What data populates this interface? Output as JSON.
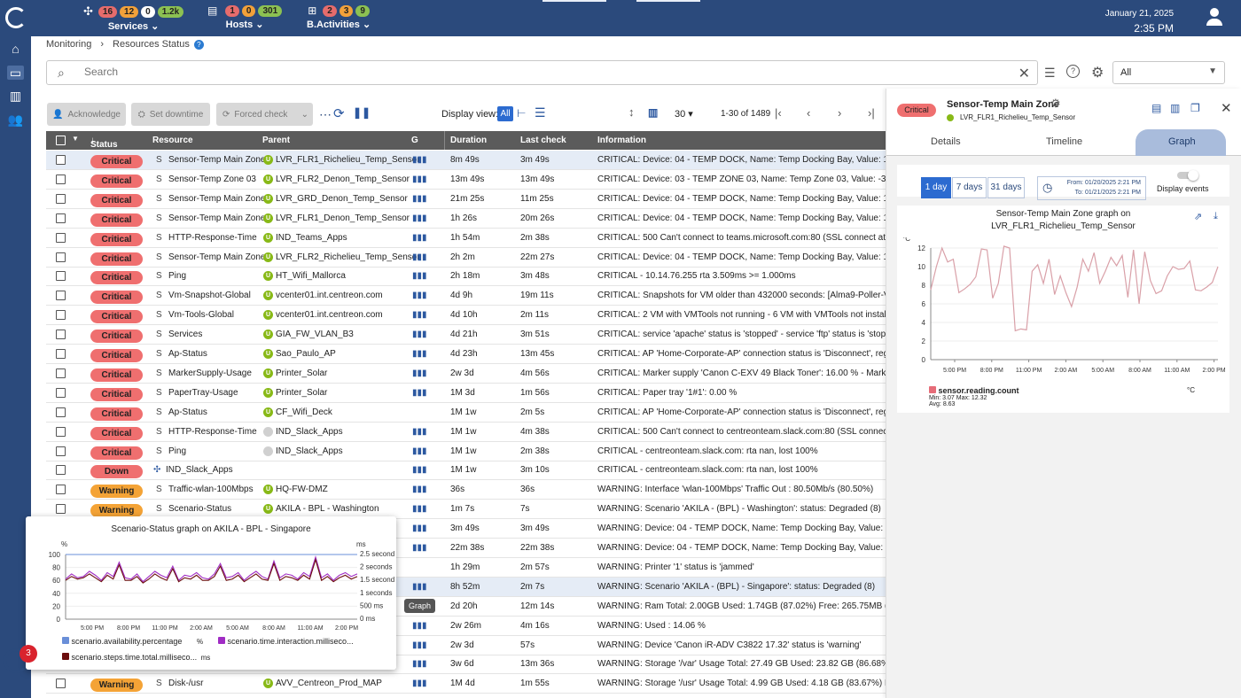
{
  "topbar": {
    "services": {
      "label": "Services",
      "counts": [
        "16",
        "12",
        "0",
        "1.2k"
      ]
    },
    "hosts": {
      "label": "Hosts",
      "counts": [
        "1",
        "0",
        "301"
      ]
    },
    "bactivities": {
      "label": "B.Activities",
      "counts": [
        "2",
        "3",
        "9"
      ]
    },
    "date": "January 21, 2025",
    "time": "2:35 PM"
  },
  "breadcrumb": {
    "root": "Monitoring",
    "current": "Resources Status"
  },
  "search": {
    "placeholder": "Search",
    "filter_value": "All"
  },
  "actions": {
    "acknowledge": "Acknowledge",
    "set_downtime": "Set downtime",
    "forced_check": "Forced check"
  },
  "view": {
    "display_view_label": "Display view:",
    "all_label": "All",
    "per_page": "30",
    "pagination": "1-30 of 1489"
  },
  "columns": {
    "status": "Status",
    "resource": "Resource",
    "parent": "Parent",
    "graph": "G",
    "duration": "Duration",
    "last_check": "Last check",
    "information": "Information"
  },
  "rows": [
    {
      "status": "Critical",
      "type": "S",
      "resource": "Sensor-Temp Main Zone",
      "parent": "LVR_FLR1_Richelieu_Temp_Sensor",
      "pcolor": "green",
      "graph": true,
      "duration": "8m 49s",
      "last_check": "3m 49s",
      "info": "CRITICAL: Device: 04 - TEMP DOCK, Name: Temp Docking Bay, Value: 12.7°C (2025-0"
    },
    {
      "status": "Critical",
      "type": "S",
      "resource": "Sensor-Temp Zone 03",
      "parent": "LVR_FLR2_Denon_Temp_Sensor",
      "pcolor": "green",
      "graph": true,
      "duration": "13m 49s",
      "last_check": "13m 49s",
      "info": "CRITICAL: Device: 03 - TEMP ZONE 03, Name: Temp Zone 03, Value: -30°C (2025-01-"
    },
    {
      "status": "Critical",
      "type": "S",
      "resource": "Sensor-Temp Main Zone",
      "parent": "LVR_GRD_Denon_Temp_Sensor",
      "pcolor": "green",
      "graph": true,
      "duration": "21m 25s",
      "last_check": "11m 25s",
      "info": "CRITICAL: Device: 04 - TEMP DOCK, Name: Temp Docking Bay, Value: 14.6°C (2025-0"
    },
    {
      "status": "Critical",
      "type": "S",
      "resource": "Sensor-Temp Main Zone",
      "parent": "LVR_FLR1_Denon_Temp_Sensor",
      "pcolor": "green",
      "graph": true,
      "duration": "1h 26s",
      "last_check": "20m 26s",
      "info": "CRITICAL: Device: 04 - TEMP DOCK, Name: Temp Docking Bay, Value: 14.1°C (2025-0"
    },
    {
      "status": "Critical",
      "type": "S",
      "resource": "HTTP-Response-Time",
      "parent": "IND_Teams_Apps",
      "pcolor": "green",
      "graph": true,
      "duration": "1h 54m",
      "last_check": "2m 38s",
      "info": "CRITICAL: 500 Can't connect to teams.microsoft.com:80 (SSL connect attempt faile"
    },
    {
      "status": "Critical",
      "type": "S",
      "resource": "Sensor-Temp Main Zone",
      "parent": "LVR_FLR2_Richelieu_Temp_Sensor",
      "pcolor": "green",
      "graph": true,
      "duration": "2h 2m",
      "last_check": "22m 27s",
      "info": "CRITICAL: Device: 04 - TEMP DOCK, Name: Temp Docking Bay, Value: 11.7°C (2025-0"
    },
    {
      "status": "Critical",
      "type": "S",
      "resource": "Ping",
      "parent": "HT_Wifi_Mallorca",
      "pcolor": "green",
      "graph": true,
      "duration": "2h 18m",
      "last_check": "3m 48s",
      "info": "CRITICAL - 10.14.76.255 rta 3.509ms >= 1.000ms"
    },
    {
      "status": "Critical",
      "type": "S",
      "resource": "Vm-Snapshot-Global",
      "parent": "vcenter01.int.centreon.com",
      "pcolor": "green",
      "graph": true,
      "duration": "4d 9h",
      "last_check": "19m 11s",
      "info": "CRITICAL: Snapshots for VM older than 432000 seconds: [Alma9-Poller-VCenter] [CE"
    },
    {
      "status": "Critical",
      "type": "S",
      "resource": "Vm-Tools-Global",
      "parent": "vcenter01.int.centreon.com",
      "pcolor": "green",
      "graph": true,
      "duration": "4d 10h",
      "last_check": "2m 11s",
      "info": "CRITICAL: 2 VM with VMTools not running - 6 VM with VMTools not installed"
    },
    {
      "status": "Critical",
      "type": "S",
      "resource": "Services",
      "parent": "GIA_FW_VLAN_B3",
      "pcolor": "green",
      "graph": true,
      "duration": "4d 21h",
      "last_check": "3m 51s",
      "info": "CRITICAL: service 'apache' status is 'stopped' - service 'ftp' status is 'stopped'"
    },
    {
      "status": "Critical",
      "type": "S",
      "resource": "Ap-Status",
      "parent": "Sao_Paulo_AP",
      "pcolor": "green",
      "graph": true,
      "duration": "4d 23h",
      "last_check": "13m 45s",
      "info": "CRITICAL: AP 'Home-Corporate-AP' connection status is 'Disconnect', registration sta"
    },
    {
      "status": "Critical",
      "type": "S",
      "resource": "MarkerSupply-Usage",
      "parent": "Printer_Solar",
      "pcolor": "green",
      "graph": true,
      "duration": "2w 3d",
      "last_check": "4m 56s",
      "info": "CRITICAL: Marker supply 'Canon C-EXV 49 Black Toner': 16.00 % - Marker supply 'Wa"
    },
    {
      "status": "Critical",
      "type": "S",
      "resource": "PaperTray-Usage",
      "parent": "Printer_Solar",
      "pcolor": "green",
      "graph": true,
      "duration": "1M 3d",
      "last_check": "1m 56s",
      "info": "CRITICAL: Paper tray '1#1': 0.00 %"
    },
    {
      "status": "Critical",
      "type": "S",
      "resource": "Ap-Status",
      "parent": "CF_Wifi_Deck",
      "pcolor": "green",
      "graph": false,
      "duration": "1M 1w",
      "last_check": "2m 5s",
      "info": "CRITICAL: AP 'Home-Corporate-AP' connection status is 'Disconnect', registration sta"
    },
    {
      "status": "Critical",
      "type": "S",
      "resource": "HTTP-Response-Time",
      "parent": "IND_Slack_Apps",
      "pcolor": "grey",
      "graph": true,
      "duration": "1M 1w",
      "last_check": "4m 38s",
      "info": "CRITICAL: 500 Can't connect to centreonteam.slack.com:80 (SSL connect attempt fa"
    },
    {
      "status": "Critical",
      "type": "S",
      "resource": "Ping",
      "parent": "IND_Slack_Apps",
      "pcolor": "grey",
      "graph": true,
      "duration": "1M 1w",
      "last_check": "2m 38s",
      "info": "CRITICAL - centreonteam.slack.com: rta nan, lost 100%"
    },
    {
      "status": "Down",
      "type": "",
      "resource": "IND_Slack_Apps",
      "parent": "",
      "pcolor": "",
      "graph": true,
      "duration": "1M 1w",
      "last_check": "3m 10s",
      "info": "CRITICAL - centreonteam.slack.com: rta nan, lost 100%"
    },
    {
      "status": "Warning",
      "type": "S",
      "resource": "Traffic-wlan-100Mbps",
      "parent": "HQ-FW-DMZ",
      "pcolor": "green",
      "graph": true,
      "duration": "36s",
      "last_check": "36s",
      "info": "WARNING: Interface 'wlan-100Mbps' Traffic Out : 80.50Mb/s (80.50%)"
    },
    {
      "status": "Warning",
      "type": "S",
      "resource": "Scenario-Status",
      "parent": "AKILA - BPL - Washington",
      "pcolor": "green",
      "graph": true,
      "duration": "1m 7s",
      "last_check": "7s",
      "info": "WARNING: Scenario 'AKILA - (BPL) - Washington': status: Degraded (8)"
    },
    {
      "status": "",
      "type": "",
      "resource": "",
      "parent": "",
      "pcolor": "",
      "graph": true,
      "duration": "3m 49s",
      "last_check": "3m 49s",
      "info": "WARNING: Device: 04 - TEMP DOCK, Name: Temp Docking Bay, Value: 9.7°C (2025-0"
    },
    {
      "status": "",
      "type": "",
      "resource": "",
      "parent": "",
      "pcolor": "",
      "graph": true,
      "duration": "22m 38s",
      "last_check": "22m 38s",
      "info": "WARNING: Device: 04 - TEMP DOCK, Name: Temp Docking Bay, Value: 9.4°C (2025-0"
    },
    {
      "status": "",
      "type": "",
      "resource": "",
      "parent": "",
      "pcolor": "",
      "graph": false,
      "duration": "1h 29m",
      "last_check": "2m 57s",
      "info": "WARNING: Printer '1' status is 'jammed'"
    },
    {
      "status": "",
      "type": "",
      "resource": "",
      "parent": "",
      "pcolor": "",
      "graph": true,
      "duration": "8h 52m",
      "last_check": "2m 7s",
      "info": "WARNING: Scenario 'AKILA - (BPL) - Singapore': status: Degraded (8)"
    },
    {
      "status": "",
      "type": "",
      "resource": "",
      "parent": "",
      "pcolor": "",
      "graph": false,
      "duration": "2d 20h",
      "last_check": "12m 14s",
      "info": "WARNING: Ram Total: 2.00GB Used: 1.74GB (87.02%) Free: 265.75MB (12.98%)"
    },
    {
      "status": "",
      "type": "",
      "resource": "",
      "parent": "",
      "pcolor": "",
      "graph": true,
      "duration": "2w 26m",
      "last_check": "4m 16s",
      "info": "WARNING: Used : 14.06 %"
    },
    {
      "status": "",
      "type": "",
      "resource": "",
      "parent": "",
      "pcolor": "",
      "graph": true,
      "duration": "2w 3d",
      "last_check": "57s",
      "info": "WARNING: Device 'Canon iR-ADV C3822 17.32' status is 'warning'"
    },
    {
      "status": "",
      "type": "",
      "resource": "",
      "parent": "",
      "pcolor": "",
      "graph": true,
      "duration": "3w 6d",
      "last_check": "13m 36s",
      "info": "WARNING: Storage '/var' Usage Total: 27.49 GB Used: 23.82 GB (86.68%) Free: 3.66 G"
    },
    {
      "status": "Warning",
      "type": "S",
      "resource": "Disk-/usr",
      "parent": "AVV_Centreon_Prod_MAP",
      "pcolor": "green",
      "graph": true,
      "duration": "1M 4d",
      "last_check": "1m 55s",
      "info": "WARNING: Storage '/usr' Usage Total: 4.99 GB Used: 4.18 GB (83.67%) Free: 834.61"
    }
  ],
  "tooltip": "Graph",
  "right_panel": {
    "status": "Critical",
    "title": "Sensor-Temp Main Zone",
    "parent": "LVR_FLR1_Richelieu_Temp_Sensor",
    "tabs": [
      "Details",
      "Timeline",
      "Graph"
    ],
    "ranges": [
      "1 day",
      "7 days",
      "31 days"
    ],
    "from": "From: 01/20/2025 2:21 PM",
    "to": "To: 01/21/2025 2:21 PM",
    "display_events": "Display events",
    "graph_title_1": "Sensor-Temp Main Zone graph on",
    "graph_title_2": "LVR_FLR1_Richelieu_Temp_Sensor",
    "unit": "°C",
    "legend_name": "sensor.reading.count",
    "legend_unit": "°C",
    "legend_minmax": "Min: 3.07  Max: 12.32",
    "legend_avg": "Avg: 8.63"
  },
  "popup": {
    "title": "Scenario-Status graph on AKILA - BPL - Singapore",
    "left_unit": "%",
    "right_unit": "ms",
    "legend": [
      {
        "name": "scenario.availability.percentage",
        "unit": "%",
        "color": "#6a8fd8"
      },
      {
        "name": "scenario.time.interaction.milliseco...",
        "unit": "",
        "color": "#a02cc4"
      },
      {
        "name": "scenario.steps.time.total.milliseco...",
        "unit": "ms",
        "color": "#6b0d0d"
      }
    ]
  },
  "notification_count": "3",
  "chart_data": [
    {
      "type": "line",
      "title": "Sensor-Temp Main Zone graph on LVR_FLR1_Richelieu_Temp_Sensor",
      "ylabel": "°C",
      "ylim": [
        0,
        12
      ],
      "yticks": [
        0,
        2,
        4,
        6,
        8,
        10,
        12
      ],
      "xticks": [
        "5:00 PM",
        "8:00 PM",
        "11:00 PM",
        "2:00 AM",
        "5:00 AM",
        "8:00 AM",
        "11:00 AM",
        "2:00 PM"
      ],
      "series": [
        {
          "name": "sensor.reading.count",
          "color": "#d9a0a8",
          "values": [
            7.5,
            10,
            12,
            10.5,
            10.8,
            7.2,
            7.6,
            8.1,
            8.9,
            11.9,
            11.8,
            6.6,
            8.2,
            12.2,
            12.0,
            3.1,
            3.3,
            3.2,
            9.5,
            10.2,
            8.2,
            10.8,
            7.0,
            9.0,
            7.2,
            5.7,
            7.8,
            10.8,
            9.5,
            11.5,
            8.2,
            9.5,
            11.0,
            10.1,
            11.2,
            6.7,
            11.8,
            6.0,
            11.6,
            8.5,
            7.1,
            7.4,
            9.0,
            10.0,
            9.7,
            9.8,
            10.6,
            7.5,
            7.4,
            7.8,
            8.3,
            10.0
          ]
        }
      ]
    },
    {
      "type": "line",
      "title": "Scenario-Status graph on AKILA - BPL - Singapore",
      "ylabel": "%",
      "ylim": [
        0,
        100
      ],
      "yticks": [
        0,
        20,
        40,
        60,
        80,
        100
      ],
      "right_ticks": [
        "0 ms",
        "500 ms",
        "1 seconds",
        "1.5 second",
        "2 seconds",
        "2.5 second"
      ],
      "xticks": [
        "5:00 PM",
        "8:00 PM",
        "11:00 PM",
        "2:00 AM",
        "5:00 AM",
        "8:00 AM",
        "11:00 AM",
        "2:00 PM"
      ],
      "series": [
        {
          "name": "scenario.availability.percentage",
          "color": "#6a8fd8",
          "values": [
            100,
            100,
            100,
            100,
            100,
            100,
            100,
            100
          ]
        },
        {
          "name": "scenario.time.interaction.milliseco...",
          "color": "#a02cc4",
          "values": [
            62,
            70,
            64,
            66,
            74,
            68,
            60,
            72,
            66,
            88,
            64,
            62,
            70,
            58,
            66,
            74,
            68,
            64,
            82,
            60,
            68,
            66,
            72,
            64,
            62,
            70,
            86,
            64,
            66,
            72,
            60,
            68,
            74,
            66,
            62,
            90,
            64,
            70,
            68,
            62,
            72,
            66,
            96,
            64,
            70,
            60,
            68,
            72,
            66,
            70
          ]
        },
        {
          "name": "scenario.steps.time.total.milliseco...",
          "color": "#6b0d0d",
          "values": [
            60,
            66,
            62,
            64,
            70,
            64,
            58,
            68,
            62,
            84,
            60,
            60,
            66,
            56,
            62,
            70,
            64,
            60,
            78,
            58,
            64,
            62,
            68,
            60,
            60,
            66,
            82,
            60,
            62,
            68,
            58,
            64,
            70,
            62,
            60,
            86,
            60,
            66,
            64,
            60,
            68,
            62,
            92,
            60,
            66,
            58,
            64,
            68,
            62,
            66
          ]
        }
      ]
    }
  ]
}
